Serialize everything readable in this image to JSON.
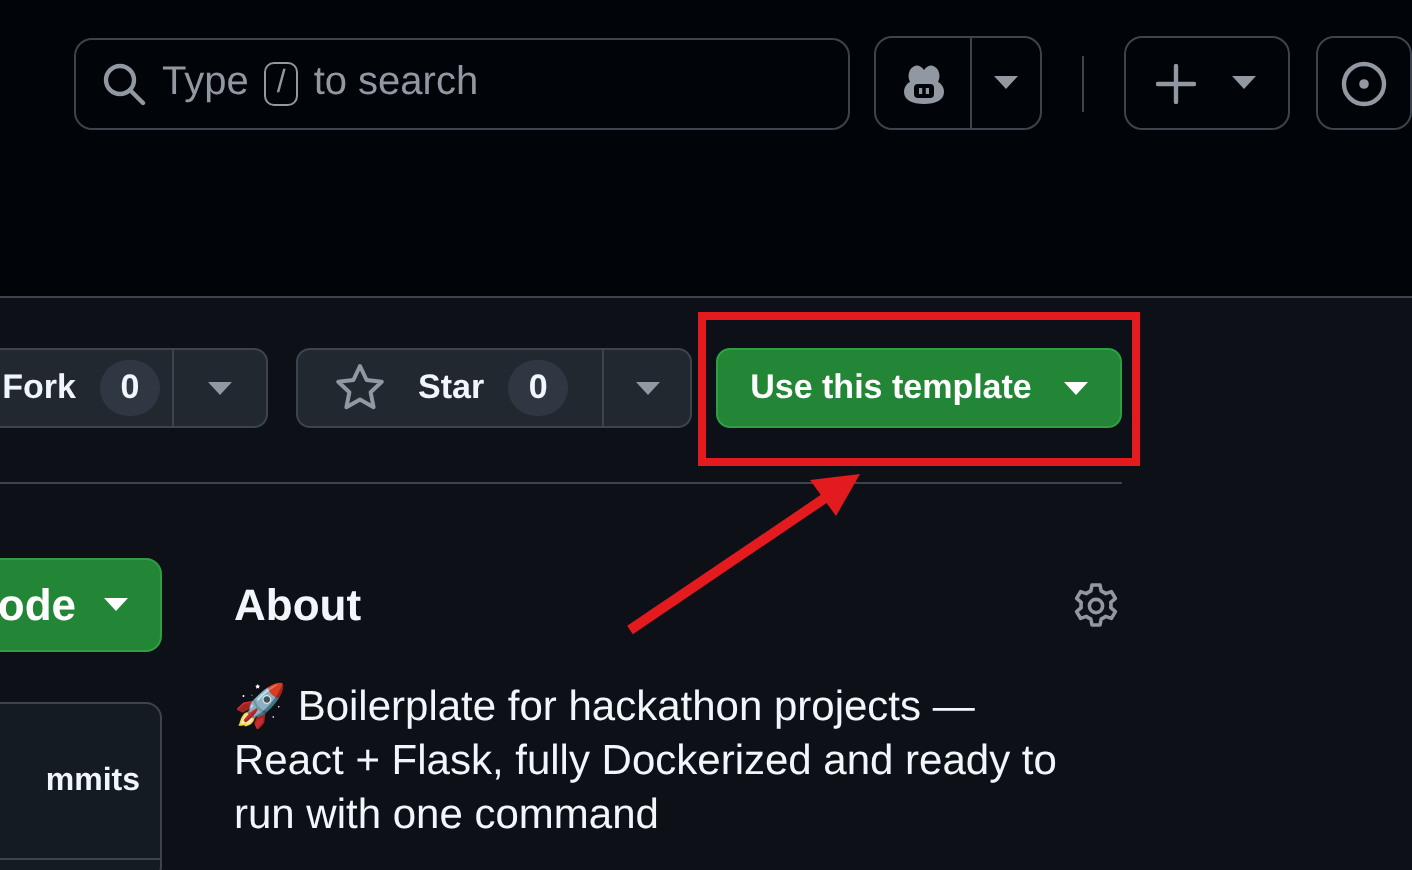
{
  "search": {
    "prefix": "Type",
    "shortcut_key": "/",
    "suffix": "to search"
  },
  "repo_actions": [
    {
      "label": "Fork",
      "count": "0"
    },
    {
      "label": "Star",
      "count": "0"
    }
  ],
  "template_button": {
    "label": "Use this template"
  },
  "code_button": {
    "label": "ode"
  },
  "commits": {
    "label": "mmits"
  },
  "about": {
    "title": "About",
    "description": "🚀 Boilerplate for hackathon projects — React + Flask, fully Dockerized and ready to run with one command"
  }
}
